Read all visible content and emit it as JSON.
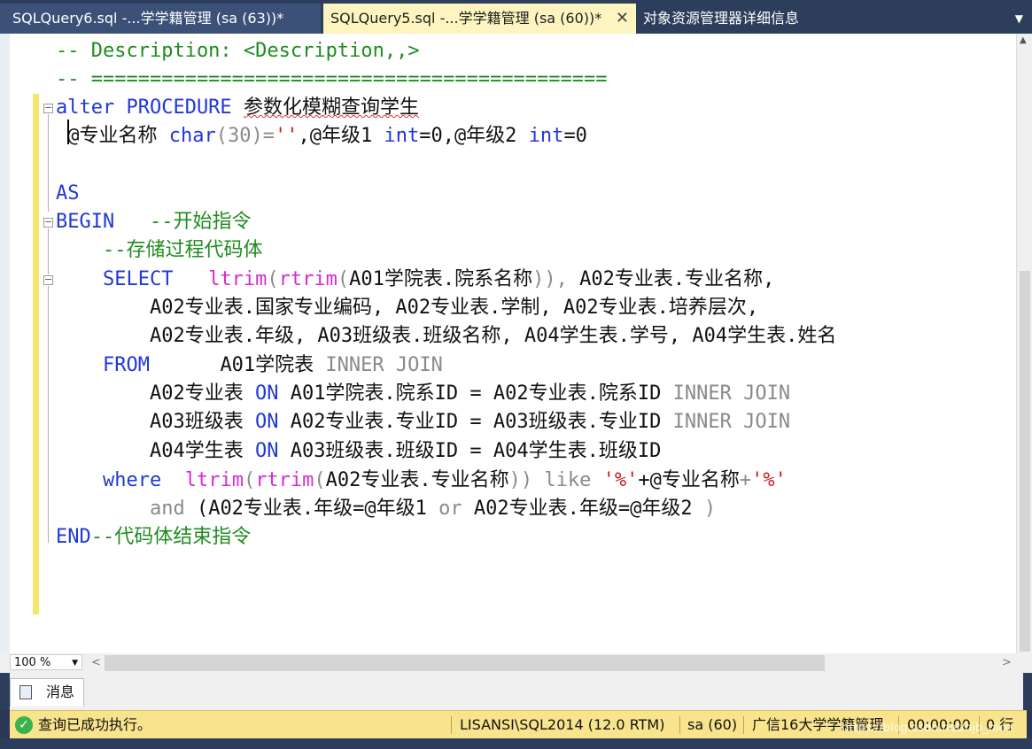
{
  "tabs": {
    "inactive": "SQLQuery6.sql -...学学籍管理 (sa (63))*",
    "active": "SQLQuery5.sql -...学学籍管理 (sa (60))*",
    "other": "对象资源管理器详细信息",
    "close_glyph": "✕",
    "dropdown_glyph": "▼"
  },
  "code": {
    "l1_comment": "-- Description: <Description,,>",
    "l2_comment": "-- ============================================",
    "l3_kw": "alter PROCEDURE",
    "l3_name": "参数化模糊查询学生",
    "l4_param1": " @专业名称 ",
    "l4_char": "char",
    "l4_len": "(30)=",
    "l4_str": "''",
    "l4_p2": ",@年级1 ",
    "l4_int1": "int",
    "l4_p3": "=0,@年级2 ",
    "l4_int2": "int",
    "l4_p4": "=0",
    "l6_as": "AS",
    "l7_begin": "BEGIN",
    "l7_comment": "   --开始指令",
    "l8_comment": "    --存储过程代码体",
    "l9_select": "    SELECT",
    "l9_ltrim": "   ltrim",
    "l9_paren1": "(",
    "l9_rtrim": "rtrim",
    "l9_paren2": "(",
    "l9_col1": "A01学院表.院系名称",
    "l9_close": ")),",
    "l9_col2": " A02专业表.专业名称,",
    "l10": "        A02专业表.国家专业编码, A02专业表.学制, A02专业表.培养层次,",
    "l11": "        A02专业表.年级, A03班级表.班级名称, A04学生表.学号, A04学生表.姓名",
    "l12_from": "    FROM",
    "l12_tbl": "      A01学院表 ",
    "l12_join": "INNER JOIN",
    "l13_tbl": "        A02专业表 ",
    "l13_on": "ON",
    "l13_cond": " A01学院表.院系ID = A02专业表.院系ID ",
    "l13_join": "INNER JOIN",
    "l14_tbl": "        A03班级表 ",
    "l14_on": "ON",
    "l14_cond": " A02专业表.专业ID = A03班级表.专业ID ",
    "l14_join": "INNER JOIN",
    "l15_tbl": "        A04学生表 ",
    "l15_on": "ON",
    "l15_cond": " A03班级表.班级ID = A04学生表.班级ID",
    "l16_where": "    where",
    "l16_ltrim": "  ltrim",
    "l16_p1": "(",
    "l16_rtrim": "rtrim",
    "l16_p2": "(",
    "l16_col": "A02专业表.专业名称",
    "l16_close": "))",
    "l16_like": " like ",
    "l16_s1": "'%'",
    "l16_plus1": "+@专业名称",
    "l16_plus2": "+",
    "l16_s2": "'%'",
    "l17_and": "        and",
    "l17_rest1": " (A02专业表.年级=@年级1 ",
    "l17_or": "or",
    "l17_rest2": " A02专业表.年级=@年级2 ",
    "l17_close": ")",
    "l18_end": "END",
    "l18_comment": "--代码体结束指令"
  },
  "zoom": {
    "value": "100 %",
    "arrow": "▼"
  },
  "scroll": {
    "left": "<",
    "right": ">",
    "up": "▲"
  },
  "messages_tab": {
    "label": "消息"
  },
  "status": {
    "ok_glyph": "✓",
    "message": "查询已成功执行。",
    "server": "LISANSI\\SQL2014 (12.0 RTM)",
    "user": "sa (60)",
    "database": "广信16大学学籍管理",
    "time": "00:00:00",
    "rows": "0 行"
  },
  "watermark": "https://blog.csdn.net/hjb_nice"
}
